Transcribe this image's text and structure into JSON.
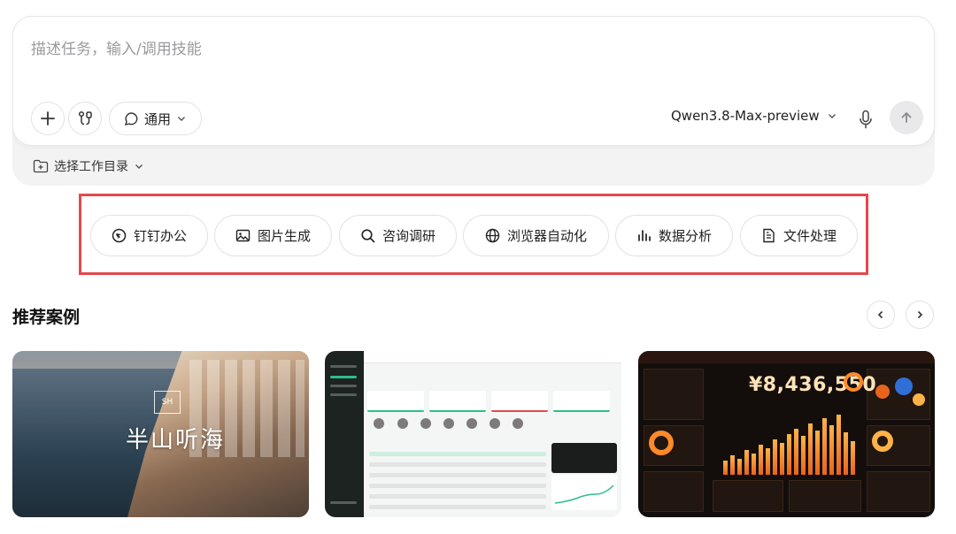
{
  "composer": {
    "placeholder": "描述任务，输入/调用技能",
    "mode_label": "通用",
    "model_label": "Qwen3.8-Max-preview"
  },
  "workdir": {
    "label": "选择工作目录"
  },
  "quick_actions": [
    {
      "label": "钉钉办公",
      "icon": "dingtalk-icon"
    },
    {
      "label": "图片生成",
      "icon": "image-icon"
    },
    {
      "label": "咨询调研",
      "icon": "search-icon"
    },
    {
      "label": "浏览器自动化",
      "icon": "globe-icon"
    },
    {
      "label": "数据分析",
      "icon": "bar-chart-icon"
    },
    {
      "label": "文件处理",
      "icon": "document-icon"
    }
  ],
  "recommended": {
    "title": "推荐案例",
    "cards": [
      {
        "name": "case-coastal-brand",
        "brand_text": "半山听海"
      },
      {
        "name": "case-dashboard"
      },
      {
        "name": "case-analytics",
        "headline_value": "¥8,436,550"
      }
    ]
  },
  "colors": {
    "highlight": "#e5484d",
    "accent_green": "#2bbf8a",
    "accent_orange": "#ff8a2a"
  }
}
